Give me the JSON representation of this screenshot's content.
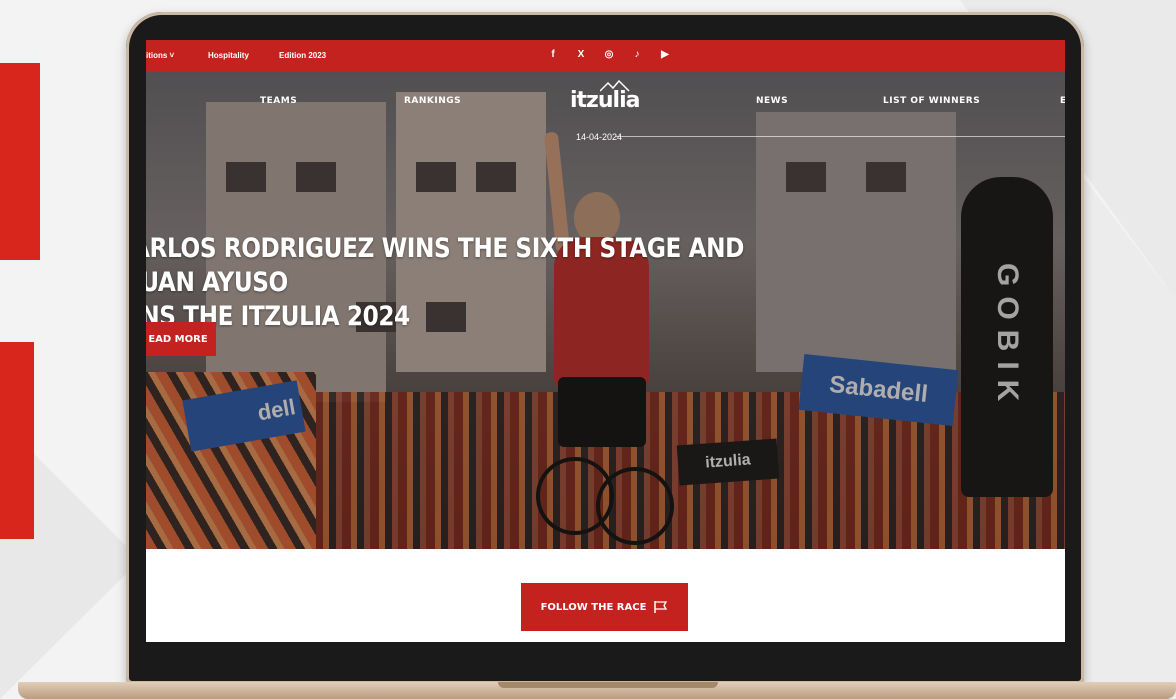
{
  "topbar": {
    "links": [
      "itions ˅",
      "Hospitality",
      "Edition 2023"
    ],
    "social_icons": [
      "facebook-icon",
      "x-icon",
      "instagram-icon",
      "tiktok-icon",
      "youtube-icon"
    ],
    "social_glyphs": [
      "f",
      "X",
      "◎",
      "♪",
      "▶"
    ]
  },
  "nav": {
    "items": [
      "TEAMS",
      "RANKINGS",
      "NEWS",
      "LIST OF WINNERS",
      "E"
    ],
    "logo": "itzulia"
  },
  "hero": {
    "date": "14-04-2024",
    "headline_line1": "ARLOS RODRIGUEZ WINS THE SIXTH STAGE AND JUAN AYUSO",
    "headline_line2": "INS THE ITZULIA 2024",
    "read_more": "EAD MORE",
    "sign_sabadell": "Sabadell",
    "sign_sabadell_left": "dell",
    "sign_gobik": "GOBIK",
    "sign_itzulia": "itzulia"
  },
  "cta": {
    "follow_label": "FOLLOW THE RACE"
  },
  "colors": {
    "brand_red": "#c4221f",
    "background": "#f3f3f3"
  }
}
